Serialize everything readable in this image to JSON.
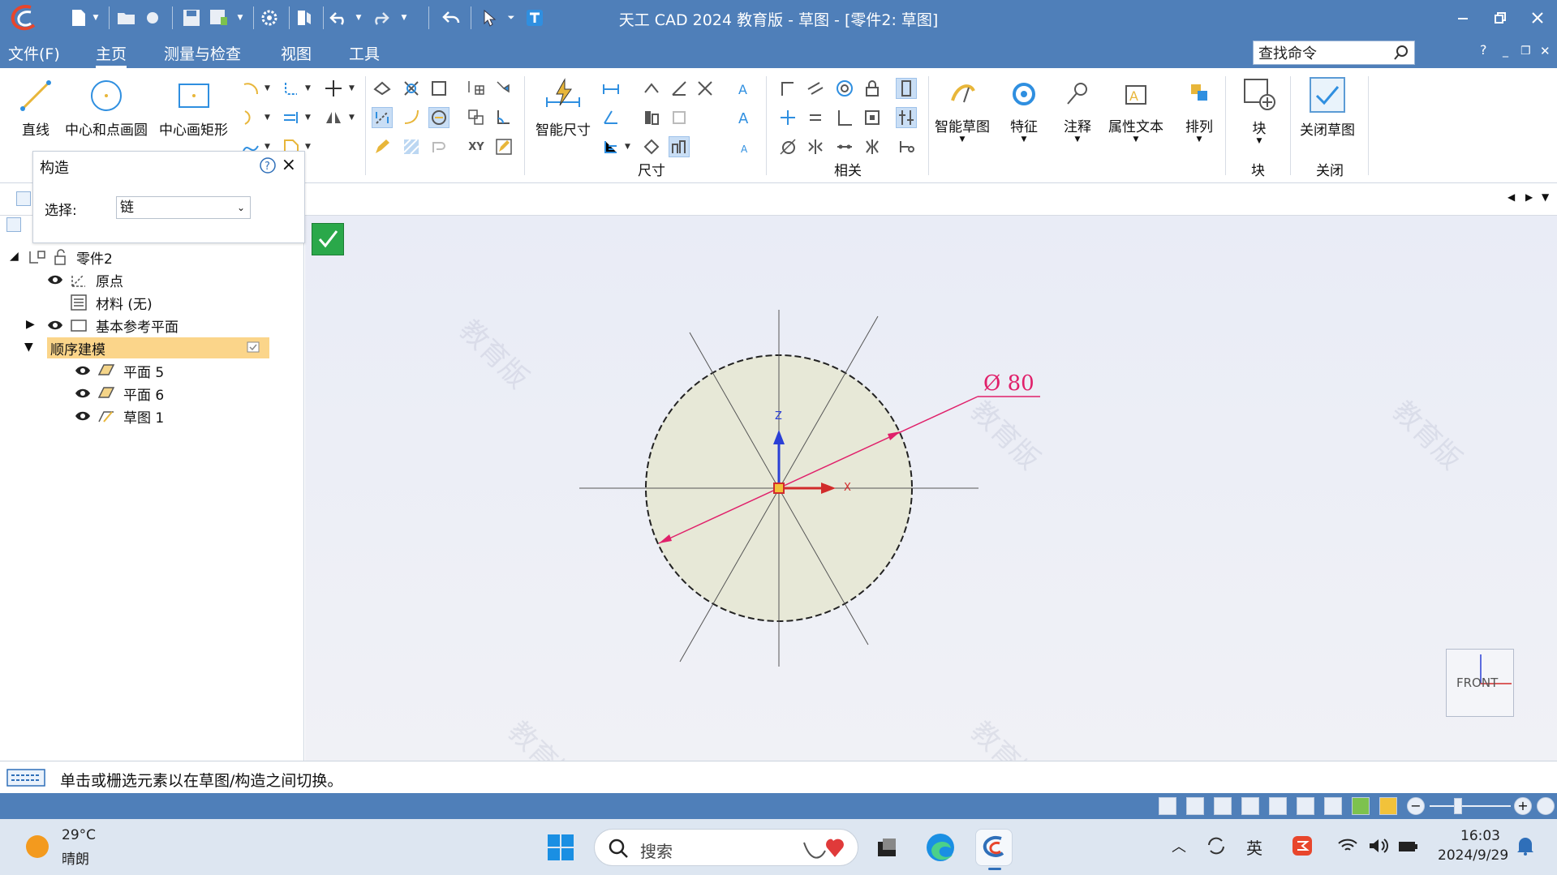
{
  "window": {
    "title": "天工 CAD 2024 教育版 - 草图 - [零件2: 草图]"
  },
  "menu": {
    "items": [
      {
        "label": "文件(F)"
      },
      {
        "label": "主页"
      },
      {
        "label": "测量与检查"
      },
      {
        "label": "视图"
      },
      {
        "label": "工具"
      }
    ],
    "active": "主页",
    "search_placeholder": "查找命令",
    "help": "?"
  },
  "ribbon": {
    "draw": [
      "直线",
      "中心和点画圆",
      "中心画矩形"
    ],
    "dimension_big": "智能尺寸",
    "group_dimension": "尺寸",
    "group_relate": "相关",
    "big_buttons": [
      "智能草图",
      "特征",
      "注释",
      "属性文本",
      "排列",
      "块"
    ],
    "close_sketch": "关闭草图",
    "group_block": "块",
    "group_close": "关闭"
  },
  "construct_panel": {
    "title": "构造",
    "select_label": "选择:",
    "select_value": "链"
  },
  "tree": {
    "root": "零件2",
    "items": [
      {
        "label": "原点"
      },
      {
        "label": "材料 (无)"
      },
      {
        "label": "基本参考平面"
      },
      {
        "label": "顺序建模"
      },
      {
        "label": "平面 5"
      },
      {
        "label": "平面 6"
      },
      {
        "label": "草图 1"
      }
    ]
  },
  "canvas": {
    "dimension_text": "Ø 80",
    "axis_z": "Z",
    "axis_x": "X",
    "view_cube": "FRONT",
    "watermark": "教育版"
  },
  "command_prompt": "单击或栅选元素以在草图/构造之间切换。",
  "taskbar": {
    "temperature": "29°C",
    "weather": "晴朗",
    "search": "搜索",
    "ime": "英",
    "time": "16:03",
    "date": "2024/9/29"
  },
  "colors": {
    "title_bar": "#4f7fb9",
    "accent_green": "#2aa84a",
    "dimension": "#e0206a",
    "tree_highlight": "#fbd58a"
  }
}
